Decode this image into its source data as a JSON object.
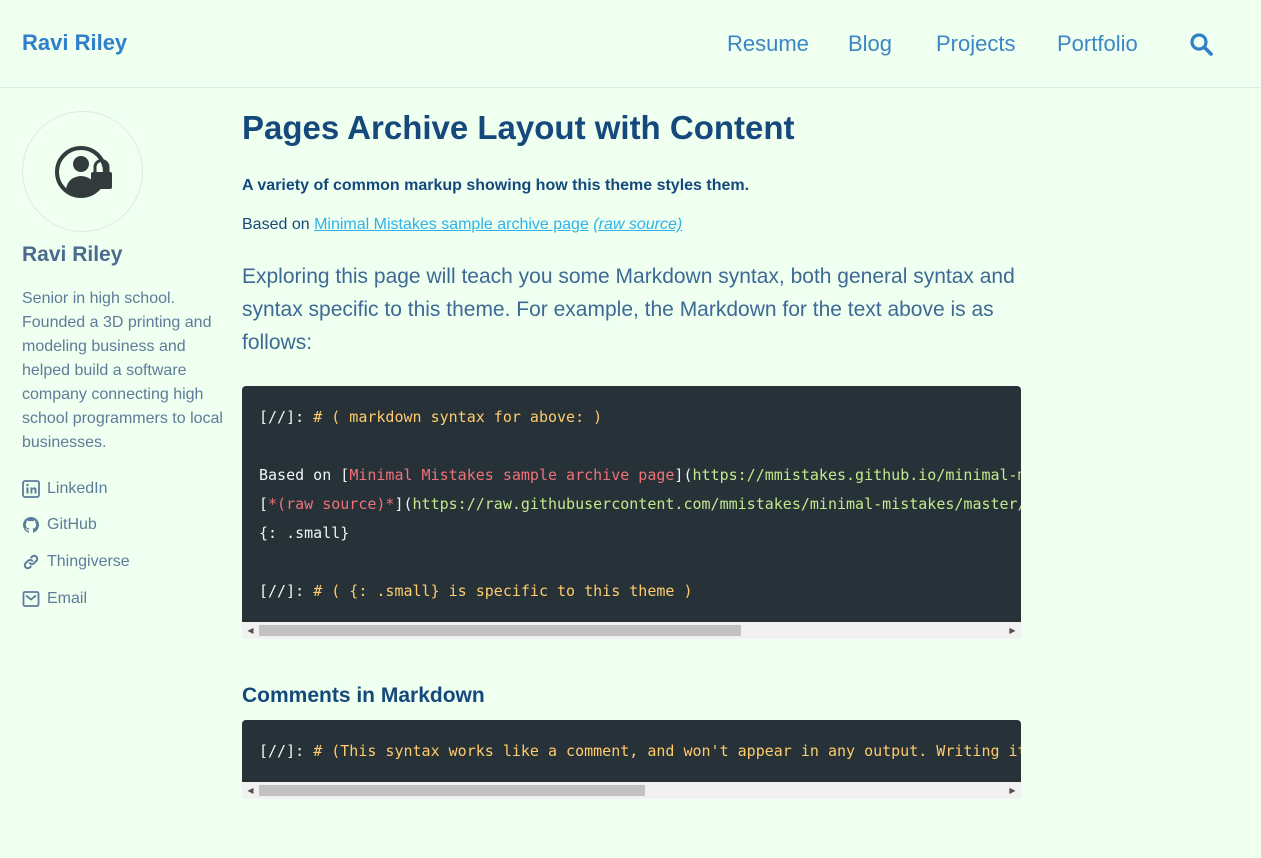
{
  "site": {
    "title": "Ravi Riley",
    "nav": [
      "Resume",
      "Blog",
      "Projects",
      "Portfolio"
    ],
    "search_icon": "search-icon"
  },
  "author": {
    "avatar_icon": "user-lock-icon",
    "name": "Ravi Riley",
    "bio": "Senior in high school. Founded a 3D printing and modeling business and helped build a software company connecting high school programmers to local businesses.",
    "links": [
      {
        "label": "LinkedIn",
        "icon": "linkedin-icon"
      },
      {
        "label": "GitHub",
        "icon": "github-icon"
      },
      {
        "label": "Thingiverse",
        "icon": "link-icon"
      },
      {
        "label": "Email",
        "icon": "email-icon"
      }
    ]
  },
  "main": {
    "title": "Pages Archive Layout with Content",
    "excerpt": "A variety of common markup showing how this theme styles them.",
    "based_on_prefix": "Based on ",
    "based_on_link": "Minimal Mistakes sample archive page",
    "raw_source_link": "(raw source)",
    "intro": "Exploring this page will teach you some Markdown syntax, both general syntax and syntax specific to this theme. For example, the Markdown for the text above is as follows:",
    "code1": {
      "line1_prefix": "[//]: ",
      "line1_comment": "# ( markdown syntax for above: )",
      "line3_text": "Based on [",
      "line3_link_text": "Minimal Mistakes sample archive page",
      "line3_mid": "](",
      "line3_url": "https://mmistakes.github.io/minimal-mistakes/year-archive/",
      "line4_open": "[",
      "line4_link_text": "*(raw source)*",
      "line4_mid": "](",
      "line4_url": "https://raw.githubusercontent.com/mmistakes/minimal-mistakes/master/docs/_pages/year-archive.md",
      "line5": "{: .small}",
      "line7_prefix": "[//]: ",
      "line7_comment": "# ( {: .small} is specific to this theme )"
    },
    "section_heading": "Comments in Markdown",
    "code2": {
      "line1_prefix": "[//]: ",
      "line1_comment": "# (This syntax works like a comment, and won't appear in any output. Writing it this way)"
    },
    "colors": {
      "background": "#effff0",
      "heading": "#15497b",
      "link": "#2fb2ea",
      "code_bg": "#263238"
    }
  }
}
